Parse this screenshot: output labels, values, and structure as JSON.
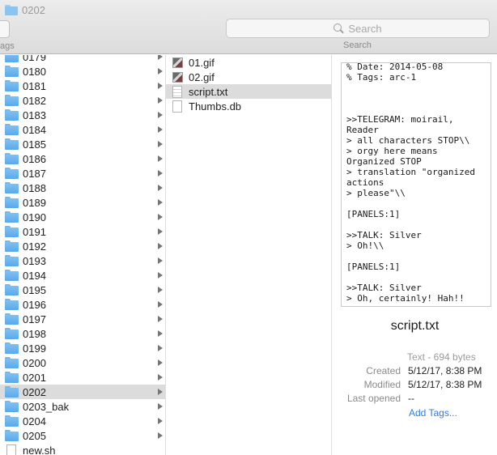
{
  "window": {
    "title": "0202"
  },
  "toolbar": {
    "tags_label": "ags",
    "search_placeholder": "Search",
    "search_caption": "Search"
  },
  "column1": {
    "items": [
      {
        "label": "0179",
        "type": "folder"
      },
      {
        "label": "0180",
        "type": "folder"
      },
      {
        "label": "0181",
        "type": "folder"
      },
      {
        "label": "0182",
        "type": "folder"
      },
      {
        "label": "0183",
        "type": "folder"
      },
      {
        "label": "0184",
        "type": "folder"
      },
      {
        "label": "0185",
        "type": "folder"
      },
      {
        "label": "0186",
        "type": "folder"
      },
      {
        "label": "0187",
        "type": "folder"
      },
      {
        "label": "0188",
        "type": "folder"
      },
      {
        "label": "0189",
        "type": "folder"
      },
      {
        "label": "0190",
        "type": "folder"
      },
      {
        "label": "0191",
        "type": "folder"
      },
      {
        "label": "0192",
        "type": "folder"
      },
      {
        "label": "0193",
        "type": "folder"
      },
      {
        "label": "0194",
        "type": "folder"
      },
      {
        "label": "0195",
        "type": "folder"
      },
      {
        "label": "0196",
        "type": "folder"
      },
      {
        "label": "0197",
        "type": "folder"
      },
      {
        "label": "0198",
        "type": "folder"
      },
      {
        "label": "0199",
        "type": "folder"
      },
      {
        "label": "0200",
        "type": "folder"
      },
      {
        "label": "0201",
        "type": "folder"
      },
      {
        "label": "0202",
        "type": "folder",
        "selected": true
      },
      {
        "label": "0203_bak",
        "type": "folder"
      },
      {
        "label": "0204",
        "type": "folder"
      },
      {
        "label": "0205",
        "type": "folder"
      },
      {
        "label": "new.sh",
        "type": "file"
      }
    ]
  },
  "column2": {
    "items": [
      {
        "label": "01.gif",
        "icon": "gif-icon"
      },
      {
        "label": "02.gif",
        "icon": "gif-icon"
      },
      {
        "label": "script.txt",
        "icon": "text-file-icon",
        "selected": true
      },
      {
        "label": "Thumbs.db",
        "icon": "file-icon"
      }
    ]
  },
  "preview": {
    "content": "% Date: 2014-05-08\n% Tags: arc-1\n\n\n\n>>TELEGRAM: moirail, Reader\n> all characters STOP\\\\\n> orgy here means Organized STOP\n> translation \"organized actions\n> please\"\\\\\n\n[PANELS:1]\n\n>>TALK: Silver\n> Oh!\\\\\n\n[PANELS:1]\n\n>>TALK: Silver\n> Oh, certainly! Hah!!",
    "file_name": "script.txt",
    "kind": "Text - 694 bytes",
    "created_label": "Created",
    "created_value": "5/12/17, 8:38 PM",
    "modified_label": "Modified",
    "modified_value": "5/12/17, 8:38 PM",
    "last_opened_label": "Last opened",
    "last_opened_value": "--",
    "add_tags": "Add Tags..."
  },
  "colors": {
    "selection": "#dcdcdc",
    "folder": "#5aa9ea",
    "link": "#2f7de1"
  }
}
